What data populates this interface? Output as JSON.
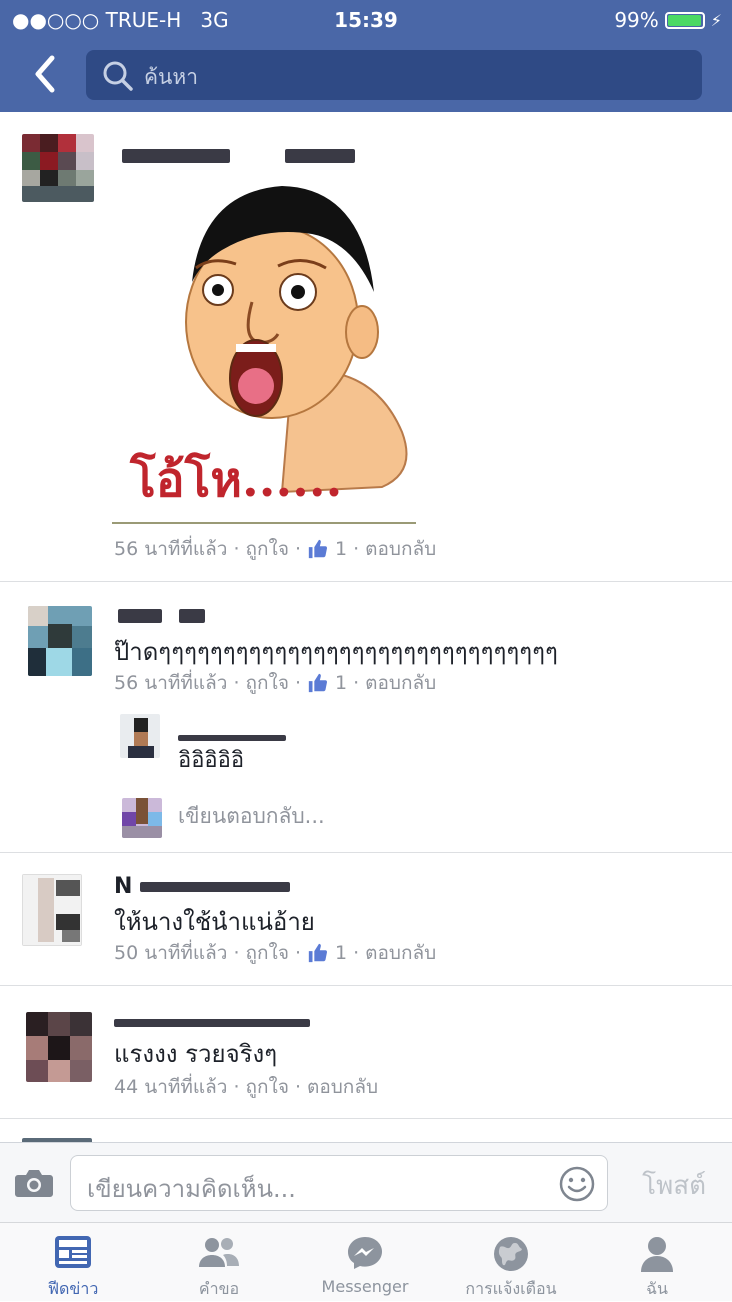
{
  "status_bar": {
    "carrier": "●●○○○ TRUE-H",
    "network": "3G",
    "time": "15:39",
    "battery": "99%"
  },
  "search": {
    "placeholder": "ค้นหา"
  },
  "comments": [
    {
      "sticker_text": "โอ้โห......",
      "meta": {
        "time": "56 นาทีที่แล้ว",
        "like": "ถูกใจ",
        "like_count": "1",
        "reply": "ตอบกลับ"
      }
    },
    {
      "text": "ป๊าดๆๆๆๆๆๆๆๆๆๆๆๆๆๆๆๆๆๆๆๆๆๆๆๆๆๆๆๆๆๆๆ",
      "meta": {
        "time": "56 นาทีที่แล้ว",
        "like": "ถูกใจ",
        "like_count": "1",
        "reply": "ตอบกลับ"
      },
      "reply": {
        "text": "อิอิอิอิอิ"
      },
      "reply_placeholder": "เขียนตอบกลับ..."
    },
    {
      "name_partial": "N",
      "text": "ให้นางใช้นำแน่อ้าย",
      "meta": {
        "time": "50 นาทีที่แล้ว",
        "like": "ถูกใจ",
        "like_count": "1",
        "reply": "ตอบกลับ"
      }
    },
    {
      "text": "แรงงง รวยจริงๆ",
      "meta": {
        "time": "44 นาทีที่แล้ว",
        "like": "ถูกใจ",
        "reply": "ตอบกลับ"
      }
    }
  ],
  "composer": {
    "placeholder": "เขียนความคิดเห็น...",
    "post_label": "โพสต์"
  },
  "tabs": [
    {
      "label": "ฟีดข่าว",
      "icon": "news-feed-icon",
      "active": true
    },
    {
      "label": "คำขอ",
      "icon": "friend-requests-icon",
      "active": false
    },
    {
      "label": "Messenger",
      "icon": "messenger-icon",
      "active": false
    },
    {
      "label": "การแจ้งเตือน",
      "icon": "globe-notifications-icon",
      "active": false
    },
    {
      "label": "ฉัน",
      "icon": "profile-icon",
      "active": false
    }
  ],
  "colors": {
    "header": "#4a67a7",
    "accent": "#4267b2",
    "meta_text": "#90949c"
  }
}
